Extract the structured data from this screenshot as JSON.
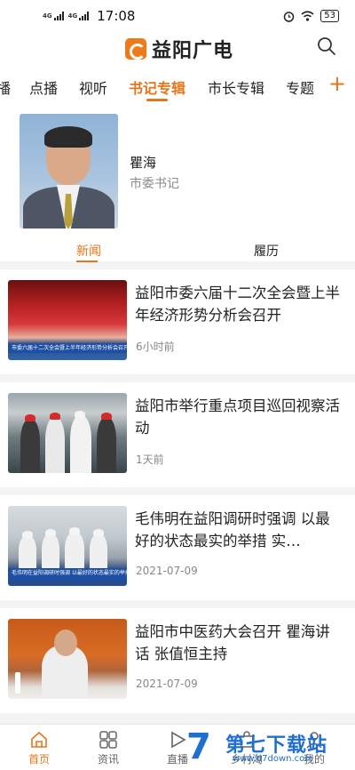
{
  "status_bar": {
    "network": "4G",
    "time": "17:08",
    "battery": "53"
  },
  "header": {
    "app_name": "益阳广电"
  },
  "tabs": [
    "播",
    "点播",
    "视听",
    "书记专辑",
    "市长专辑",
    "专题"
  ],
  "tab_add": "+",
  "profile": {
    "name": "瞿海",
    "title": "市委书记",
    "sub_tabs": [
      "新闻",
      "履历"
    ]
  },
  "news": [
    {
      "title": "益阳市委六届十二次全会暨上半年经济形势分析会召开",
      "time": "6小时前",
      "thumb_caption": "市委六届十二次全会暨上半年经济形势分析会召开"
    },
    {
      "title": "益阳市举行重点项目巡回视察活动",
      "time": "1天前"
    },
    {
      "title": "毛伟明在益阳调研时强调 以最好的状态最实的举措 实…",
      "time": "2021-07-09",
      "thumb_caption": "毛伟明在益阳调研时强调 以最好的状态最实的举措"
    },
    {
      "title": "益阳市中医药大会召开 瞿海讲话 张值恒主持",
      "time": "2021-07-09"
    }
  ],
  "bottom_nav": [
    {
      "label": "首页",
      "icon": "home-icon"
    },
    {
      "label": "资讯",
      "icon": "grid-icon"
    },
    {
      "label": "直播",
      "icon": "play-icon"
    },
    {
      "label": "乡村淘",
      "icon": "shop-icon"
    },
    {
      "label": "我的",
      "icon": "user-icon"
    }
  ],
  "watermark": {
    "brand": "第七下载站",
    "url": "www.d7down.com",
    "digit": "7"
  },
  "colors": {
    "accent": "#e8751a",
    "watermark": "#1f6fd0"
  }
}
